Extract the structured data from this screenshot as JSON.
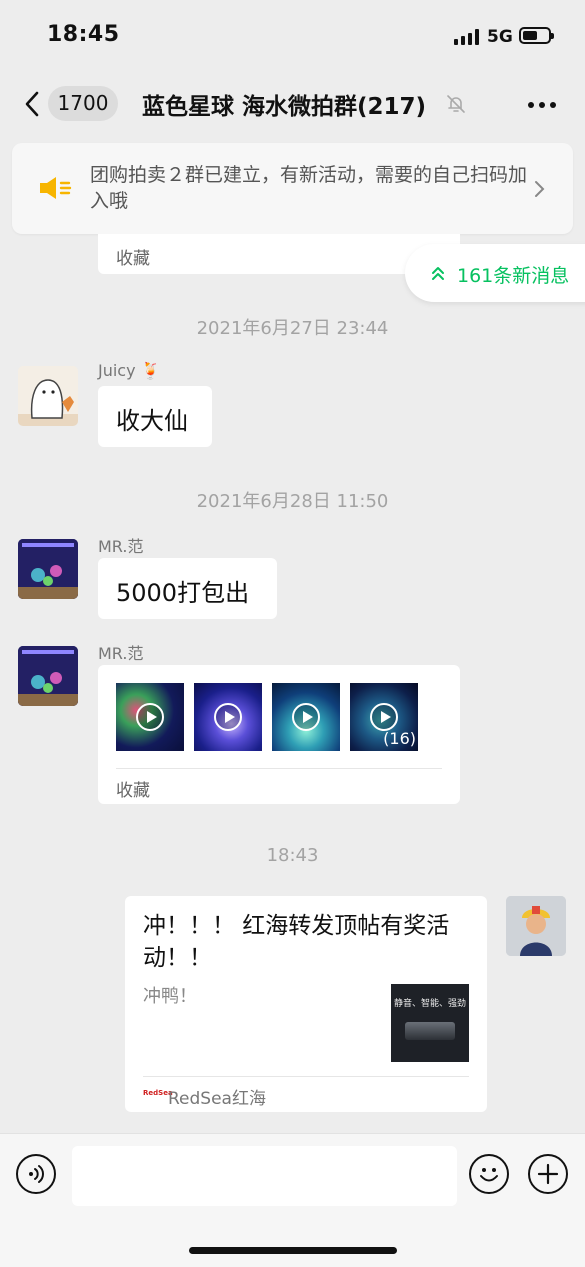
{
  "status_bar": {
    "time": "18:45",
    "network": "5G",
    "battery_level": 0.6
  },
  "nav": {
    "unread_count": "1700",
    "title": "蓝色星球 海水微拍群(217)"
  },
  "notice": {
    "text": "团购拍卖２群已建立，有新活动，需要的自己扫码加入哦"
  },
  "new_messages_pill": {
    "label": "161条新消息"
  },
  "messages": {
    "partial": {
      "fav_label": "收藏"
    },
    "ts1": "2021年6月27日 23:44",
    "juicy": {
      "name": "Juicy 🍹",
      "text": "收大仙"
    },
    "ts2": "2021年6月28日 11:50",
    "fan1": {
      "name": "MR.范",
      "text": "5000打包出"
    },
    "fan2": {
      "name": "MR.范",
      "more_count": "(16)",
      "fav_label": "收藏"
    },
    "ts3": "18:43",
    "link": {
      "title": "冲！！！ 红海转发顶帖有奖活动！！",
      "desc": "冲鸭！",
      "thumb_caption": "静音、智能、强劲",
      "source": "RedSea红海",
      "source_logo": "RedSea"
    }
  },
  "colors": {
    "accent": "#07c160",
    "background": "#ededed",
    "bubble": "#ffffff",
    "notice_icon": "#f7b500"
  }
}
